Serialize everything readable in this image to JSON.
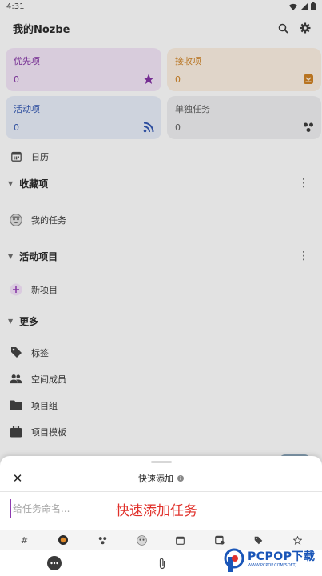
{
  "status_bar": {
    "time": "4:31"
  },
  "app_bar": {
    "title": "我的Nozbe"
  },
  "cards": {
    "priority": {
      "label": "优先项",
      "count": "0",
      "color": "#7a2a9a"
    },
    "inbox": {
      "label": "接收项",
      "count": "0",
      "color": "#c4781a"
    },
    "active": {
      "label": "活动项",
      "count": "0",
      "color": "#2b4fa8"
    },
    "single": {
      "label": "单独任务",
      "count": "0",
      "color": "#555555"
    }
  },
  "nav": {
    "calendar": "日历"
  },
  "favorites": {
    "title": "收藏项",
    "items": [
      "我的任务"
    ]
  },
  "active_projects": {
    "title": "活动项目",
    "items": [
      "新项目"
    ]
  },
  "more": {
    "title": "更多",
    "items": [
      "标签",
      "空间成员",
      "项目组",
      "项目模板"
    ]
  },
  "quick_add": {
    "title": "快速添加",
    "placeholder": "给任务命名...",
    "annotation": "快速添加任务"
  },
  "watermark": {
    "main": "PCPOP下载",
    "sub": "WWW.PCPOP.COM/SOFT/"
  }
}
